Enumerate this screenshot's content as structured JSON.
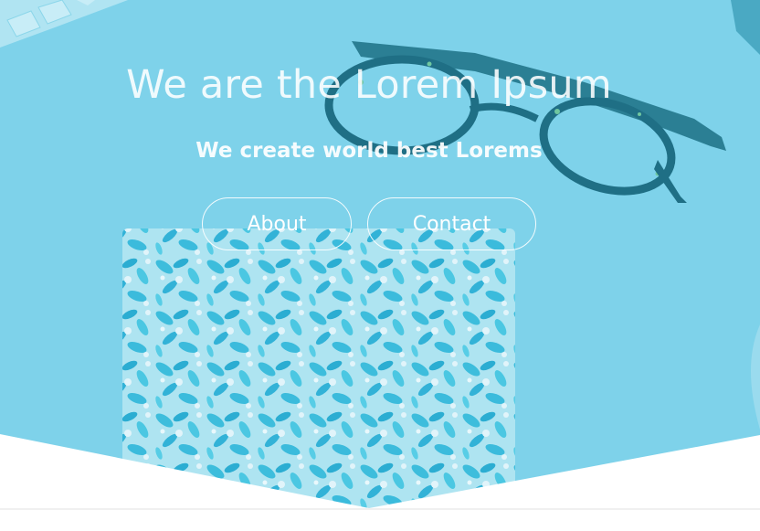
{
  "hero": {
    "title": "We are the Lorem Ipsum",
    "subtitle": "We create world best Lorems",
    "buttons": {
      "about_label": "About",
      "contact_label": "Contact"
    },
    "overlay_color": "#7fd2ea",
    "accent_color": "#1fb3d6"
  },
  "icons": {
    "glasses": "glasses-icon",
    "notebook": "floral-notebook-icon",
    "keyboard": "keyboard-icon"
  }
}
